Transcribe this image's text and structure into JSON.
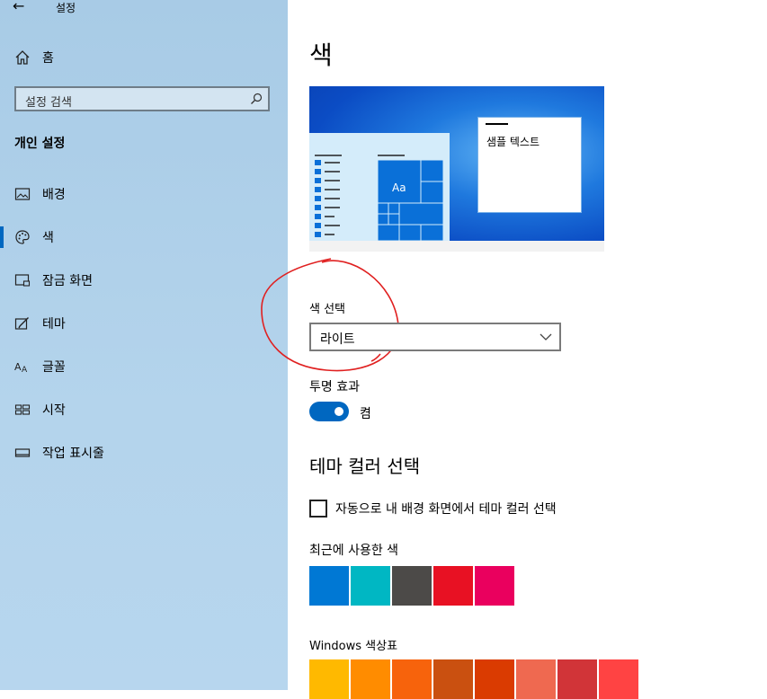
{
  "window": {
    "title": "설정"
  },
  "sidebar": {
    "home_label": "홈",
    "search_placeholder": "설정 검색",
    "section_title": "개인 설정",
    "items": [
      {
        "label": "배경",
        "icon": "picture-icon"
      },
      {
        "label": "색",
        "icon": "palette-icon",
        "selected": true
      },
      {
        "label": "잠금 화면",
        "icon": "lock-screen-icon"
      },
      {
        "label": "테마",
        "icon": "theme-brush-icon"
      },
      {
        "label": "글꼴",
        "icon": "font-icon"
      },
      {
        "label": "시작",
        "icon": "start-icon"
      },
      {
        "label": "작업 표시줄",
        "icon": "taskbar-icon"
      }
    ]
  },
  "main": {
    "title": "색",
    "preview": {
      "sample_text": "샘플 텍스트",
      "tile_text": "Aa"
    },
    "color_choice": {
      "label": "색 선택",
      "value": "라이트"
    },
    "transparency": {
      "label": "투명 효과",
      "state": "켬",
      "on": true
    },
    "accent": {
      "heading": "테마 컬러 선택",
      "auto_checkbox_label": "자동으로 내 배경 화면에서 테마 컬러 선택",
      "auto_checked": false,
      "recent_label": "최근에 사용한 색",
      "recent_colors": [
        "#0078d4",
        "#00b7c3",
        "#4c4a48",
        "#e81123",
        "#ea005e"
      ],
      "palette_label": "Windows 색상표",
      "palette_colors": [
        "#ffb900",
        "#ff8c00",
        "#f7630c",
        "#ca5010",
        "#da3b01",
        "#ef6950",
        "#d13438",
        "#ff4343"
      ]
    }
  },
  "colors": {
    "accent": "#0067c0",
    "sidebar_bg": "#b0d1ea"
  }
}
